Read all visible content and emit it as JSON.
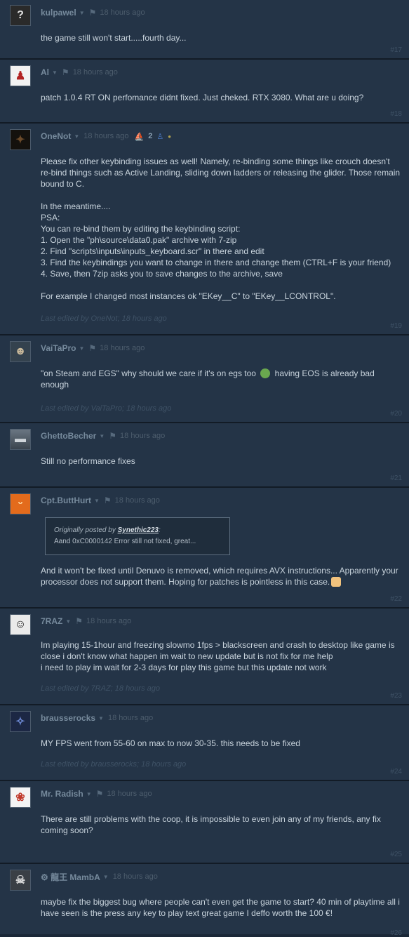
{
  "posts": [
    {
      "author": "kulpawel",
      "time": "18 hours ago",
      "text": "the game still won't start.....fourth day...",
      "edited": "",
      "number": "#17",
      "avatar": "question-mark"
    },
    {
      "author": "Al",
      "time": "18 hours ago",
      "text": "patch 1.0.4 RT ON perfomance didnt fixed. Just cheked. RTX 3080. What are u doing?",
      "edited": "",
      "number": "#18",
      "avatar": "red-figure"
    },
    {
      "author": "OneNot",
      "time": "18 hours ago",
      "badge_count": "2",
      "text": "Please fix other keybinding issues as well! Namely, re-binding some things like crouch doesn't re-bind things such as Active Landing, sliding down ladders or releasing the glider. Those remain bound to C.\n\nIn the meantime....\nPSA:\nYou can re-bind them by editing the keybinding script:\n1. Open the \"ph\\source\\data0.pak\" archive with 7-zip\n2. Find \"scripts\\inputs\\inputs_keyboard.scr\" in there and edit\n3. Find the keybindings you want to change in there and change them (CTRL+F is your friend)\n4. Save, then 7zip asks you to save changes to the archive, save\n\nFor example I changed most instances ok \"EKey__C\" to \"EKey__LCONTROL\".",
      "edited": "Last edited by OneNot; 18 hours ago",
      "number": "#19",
      "avatar": "dark"
    },
    {
      "author": "VaiTaPro",
      "time": "18 hours ago",
      "text_before": "\"on Steam and EGS\" why should we care if it's on egs too",
      "text_after": "having EOS is already bad enough",
      "edited": "Last edited by VaiTaPro; 18 hours ago",
      "number": "#20",
      "avatar": "face"
    },
    {
      "author": "GhettoBecher",
      "time": "18 hours ago",
      "text": "Still no performance fixes",
      "edited": "",
      "number": "#21",
      "avatar": "landscape"
    },
    {
      "author": "Cpt.ButtHurt",
      "time": "18 hours ago",
      "quote_prefix": "Originally posted by",
      "quote_author": "Synethic223",
      "quote_text": "Aand 0xC0000142 Error still not fixed, great...",
      "text": "And it won't be fixed until Denuvo is removed, which requires AVX instructions... Apparently your processor does not support them. Hoping for patches is pointless in this case.",
      "edited": "",
      "number": "#22",
      "avatar": "orange"
    },
    {
      "author": "7RAZ",
      "time": "18 hours ago",
      "text": "Im playing 15-1hour and freezing slowmo 1fps > blackscreen and crash to desktop like game is close i don't know what happen im wait to new update but is not fix for me help\ni need to play im wait for 2-3 days for play this game but this update not work",
      "edited": "Last edited by 7RAZ; 18 hours ago",
      "number": "#23",
      "avatar": "bearded"
    },
    {
      "author": "brausserocks",
      "time": "18 hours ago",
      "text": "MY FPS went from 55-60 on max to now 30-35. this needs to be fixed",
      "edited": "Last edited by brausserocks; 18 hours ago",
      "number": "#24",
      "avatar": "blue"
    },
    {
      "author": "Mr. Radish",
      "time": "18 hours ago",
      "text": "There are still problems with the coop, it is impossible to even join any of my friends, any fix coming soon?",
      "edited": "",
      "number": "#25",
      "avatar": "radish"
    },
    {
      "author": "⚙ 龍王 MambA",
      "time": "18 hours ago",
      "text": "maybe fix the biggest bug where people can't even get the game to start? 40 min of playtime all i have seen is the press any key to play text great game I deffo worth the 100 €!",
      "edited": "",
      "number": "#26",
      "avatar": "skull"
    }
  ],
  "colors": {
    "background": "#1b2838",
    "post_bg": "#243447",
    "author": "#768a9c",
    "text": "#c8d3dc"
  }
}
